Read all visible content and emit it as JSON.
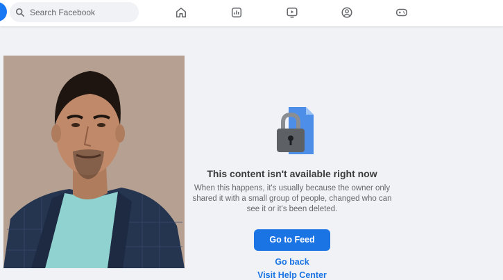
{
  "header": {
    "search_placeholder": "Search Facebook",
    "nav": [
      {
        "icon": "home-icon"
      },
      {
        "icon": "pages-icon"
      },
      {
        "icon": "watch-icon"
      },
      {
        "icon": "groups-icon"
      },
      {
        "icon": "gaming-icon"
      }
    ]
  },
  "message": {
    "title": "This content isn't available right now",
    "description": "When this happens, it's usually because the owner only shared it with a small group of people, changed who can see it or it's been deleted.",
    "primary_button": "Go to Feed",
    "back_link": "Go back",
    "help_link": "Visit Help Center"
  },
  "colors": {
    "accent": "#1b74e4",
    "background": "#f0f2f5",
    "photo_background": "#b19a8c"
  }
}
